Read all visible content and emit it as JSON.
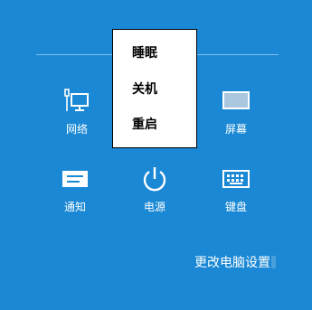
{
  "colors": {
    "background": "#1a88d4",
    "menu_background": "#ffffff",
    "menu_text": "#000000"
  },
  "tiles": [
    {
      "label": "网络",
      "icon": "network-icon"
    },
    {
      "label": "屏幕",
      "icon": "screen-icon"
    },
    {
      "label": "通知",
      "icon": "notification-icon"
    },
    {
      "label": "电源",
      "icon": "power-icon"
    },
    {
      "label": "键盘",
      "icon": "keyboard-icon"
    }
  ],
  "power_menu": {
    "items": [
      {
        "label": "睡眠"
      },
      {
        "label": "关机"
      },
      {
        "label": "重启"
      }
    ]
  },
  "change_pc_settings": "更改电脑设置"
}
